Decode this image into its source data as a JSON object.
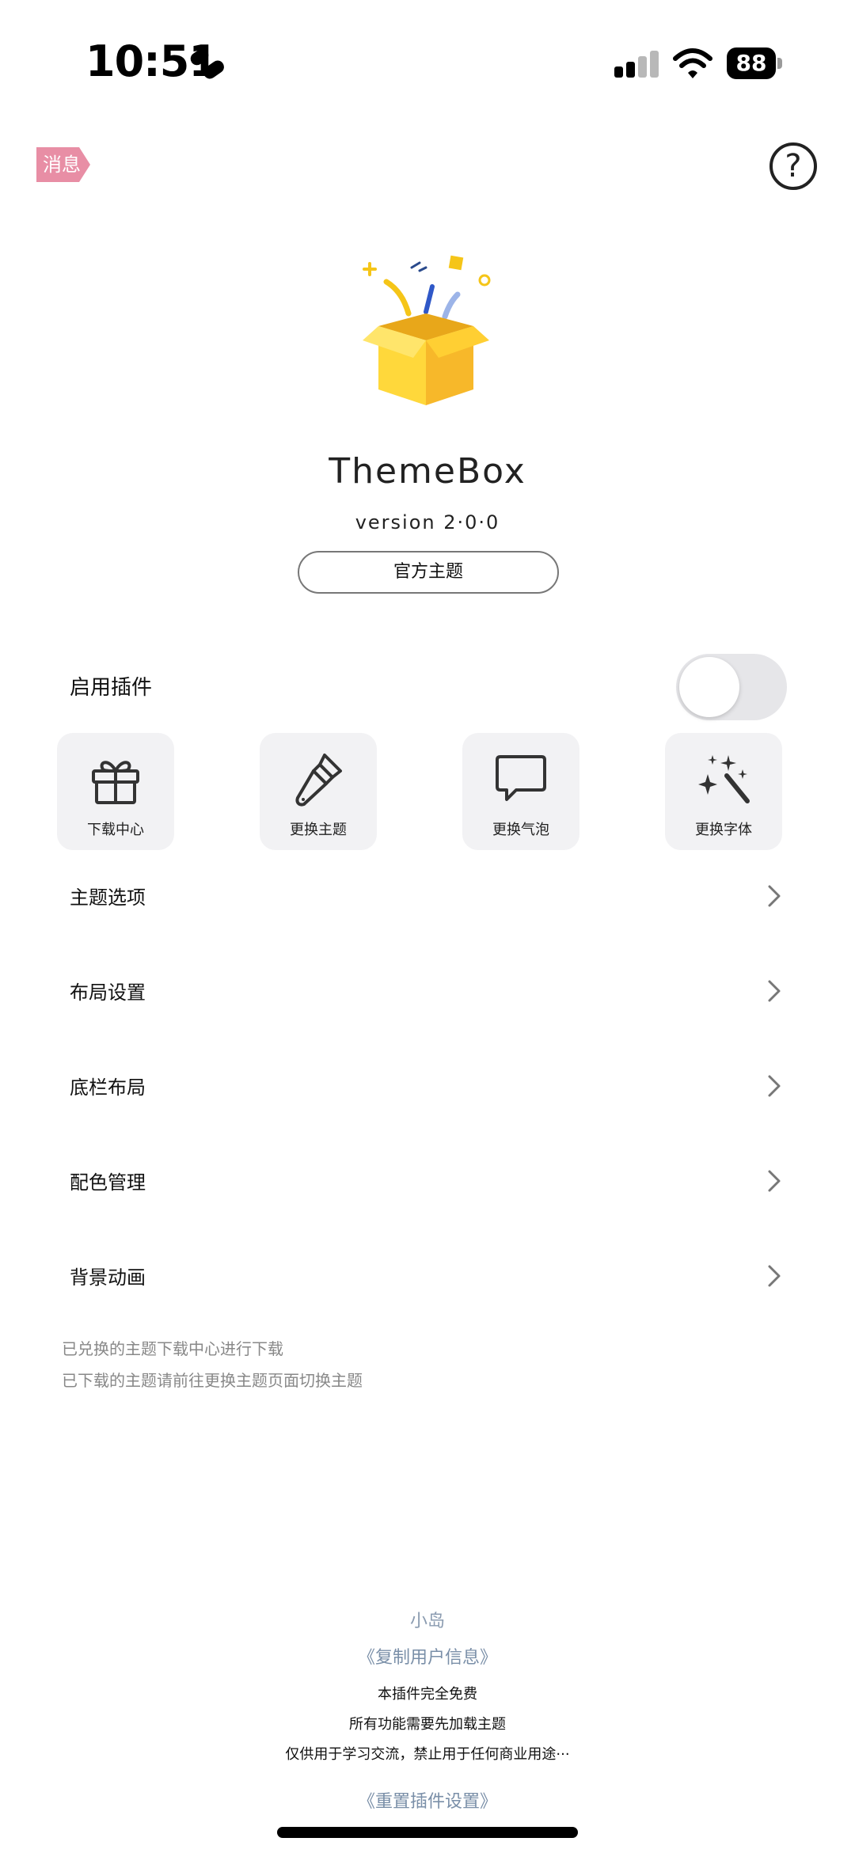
{
  "status_bar": {
    "time": "10:51",
    "battery": "88"
  },
  "header": {
    "message_tag": "消息",
    "message_color": "#e88ea5"
  },
  "hero": {
    "app_name": "ThemeBox",
    "version": "version 2·0·0",
    "official_button": "官方主题"
  },
  "plugin": {
    "enable_label": "启用插件",
    "enabled": false
  },
  "tiles": [
    {
      "label": "下载中心",
      "icon": "gift-icon"
    },
    {
      "label": "更换主题",
      "icon": "paintbrush-icon"
    },
    {
      "label": "更换气泡",
      "icon": "speech-bubble-icon"
    },
    {
      "label": "更换字体",
      "icon": "magic-wand-icon"
    }
  ],
  "menu": [
    {
      "label": "主题选项"
    },
    {
      "label": "布局设置"
    },
    {
      "label": "底栏布局"
    },
    {
      "label": "配色管理"
    },
    {
      "label": "背景动画"
    }
  ],
  "notes": [
    "已兑换的主题下载中心进行下载",
    "已下载的主题请前往更换主题页面切换主题"
  ],
  "footer": {
    "user": "小岛",
    "copy_user_info": "《复制用户信息》",
    "line1": "本插件完全免费",
    "line2": "所有功能需要先加载主题",
    "line3": "仅供用于学习交流，禁止用于任何商业用途···",
    "reset_settings": "《重置插件设置》"
  }
}
